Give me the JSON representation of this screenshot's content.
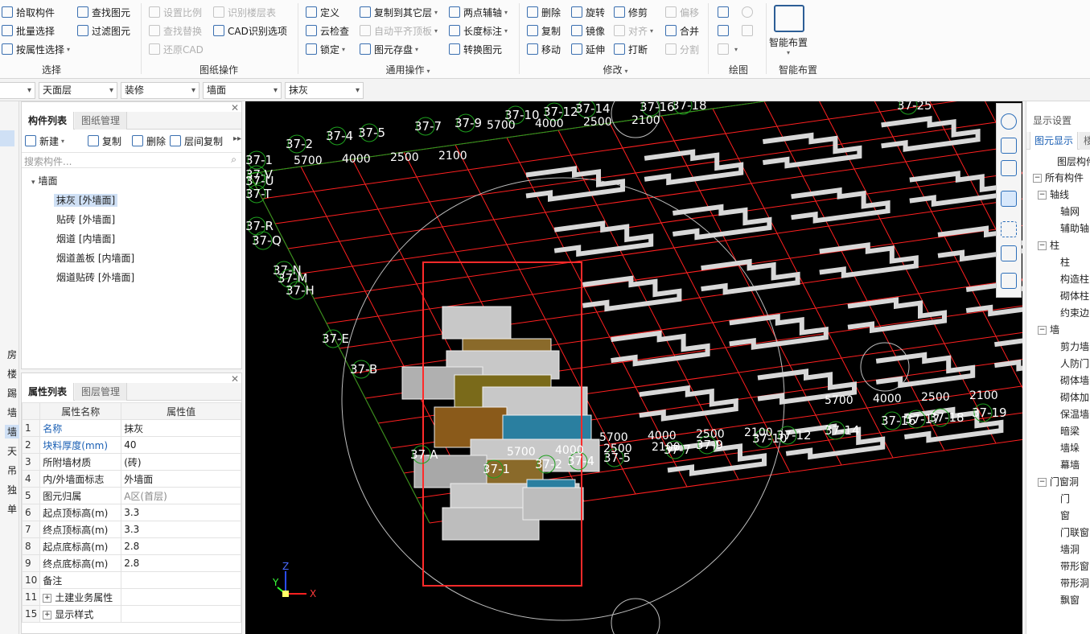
{
  "ribbon": {
    "select_group": {
      "items": [
        "拾取构件",
        "查找图元",
        "批量选择",
        "过滤图元",
        "按属性选择"
      ],
      "label": "选择"
    },
    "drawing_ops": {
      "items": [
        "设置比例",
        "识别楼层表",
        "查找替换",
        "CAD识别选项",
        "还原CAD"
      ],
      "label": "图纸操作"
    },
    "general_ops": {
      "items": [
        "定义",
        "复制到其它层",
        "两点辅轴",
        "云检查",
        "自动平齐顶板",
        "长度标注",
        "锁定",
        "图元存盘",
        "转换图元"
      ],
      "label": "通用操作"
    },
    "modify": {
      "items": [
        "删除",
        "旋转",
        "修剪",
        "偏移",
        "复制",
        "镜像",
        "对齐",
        "合并",
        "移动",
        "延伸",
        "打断",
        "分割"
      ],
      "label": "修改"
    },
    "draw": {
      "label": "绘图"
    },
    "smart": {
      "button": "智能布置",
      "label": "智能布置"
    }
  },
  "filters": [
    "天面层",
    "装修",
    "墙面",
    "抹灰"
  ],
  "left_strip": [
    "房",
    "楼",
    "踢",
    "墙",
    "墙",
    "天",
    "吊",
    "独",
    "单"
  ],
  "component_panel": {
    "tabs": [
      "构件列表",
      "图纸管理"
    ],
    "toolbar": [
      "新建",
      "复制",
      "删除",
      "层间复制"
    ],
    "search_placeholder": "搜索构件...",
    "tree_root": "墙面",
    "tree_items": [
      "抹灰 [外墙面]",
      "贴砖 [外墙面]",
      "烟道 [内墙面]",
      "烟道盖板 [内墙面]",
      "烟道贴砖 [外墙面]"
    ]
  },
  "property_panel": {
    "tabs": [
      "属性列表",
      "图层管理"
    ],
    "headers": [
      "属性名称",
      "属性值"
    ],
    "rows": [
      {
        "n": "1",
        "k": "名称",
        "v": "抹灰"
      },
      {
        "n": "2",
        "k": "块料厚度(mm)",
        "v": "40"
      },
      {
        "n": "3",
        "k": "所附墙材质",
        "v": "(砖)"
      },
      {
        "n": "4",
        "k": "内/外墙面标志",
        "v": "外墙面"
      },
      {
        "n": "5",
        "k": "图元归属",
        "v": "A区(首层)"
      },
      {
        "n": "6",
        "k": "起点顶标高(m)",
        "v": "3.3"
      },
      {
        "n": "7",
        "k": "终点顶标高(m)",
        "v": "3.3"
      },
      {
        "n": "8",
        "k": "起点底标高(m)",
        "v": "2.8"
      },
      {
        "n": "9",
        "k": "终点底标高(m)",
        "v": "2.8"
      },
      {
        "n": "10",
        "k": "备注",
        "v": ""
      },
      {
        "n": "11",
        "k": "土建业务属性",
        "v": ""
      },
      {
        "n": "15",
        "k": "显示样式",
        "v": ""
      }
    ]
  },
  "viewport": {
    "axis_labels_top": [
      "37-2",
      "37-4",
      "37-5",
      "37-7",
      "37-9",
      "37-10",
      "37-12",
      "37-14",
      "37-16",
      "37-18",
      "37-25"
    ],
    "axis_labels_left": [
      "37-1",
      "37-V",
      "37-U",
      "37-T",
      "37-R",
      "37-Q",
      "37-N",
      "37-M",
      "37-H",
      "37-E",
      "37-B",
      "37-A"
    ],
    "axis_labels_front": [
      "37-7",
      "37-9",
      "37-10",
      "37-12",
      "37-14",
      "37-16",
      "37-17",
      "37-18",
      "37-19",
      "37-1",
      "37-2",
      "37-4",
      "37-5"
    ],
    "dimensions": [
      "5700",
      "4000",
      "2500",
      "2100"
    ],
    "axes": {
      "x": "X",
      "y": "Y",
      "z": "Z"
    }
  },
  "right_panel": {
    "title": "显示设置",
    "tab": "图元显示",
    "tab2": "楼",
    "header": "图层构件",
    "items": [
      {
        "t": "所有构件",
        "lvl": 0,
        "pm": "−"
      },
      {
        "t": "轴线",
        "lvl": 1,
        "pm": "−"
      },
      {
        "t": "轴网",
        "lvl": 2
      },
      {
        "t": "辅助轴",
        "lvl": 2
      },
      {
        "t": "柱",
        "lvl": 1,
        "pm": "−"
      },
      {
        "t": "柱",
        "lvl": 2
      },
      {
        "t": "构造柱",
        "lvl": 2
      },
      {
        "t": "砌体柱",
        "lvl": 2
      },
      {
        "t": "约束边",
        "lvl": 2
      },
      {
        "t": "墙",
        "lvl": 1,
        "pm": "−"
      },
      {
        "t": "剪力墙",
        "lvl": 2
      },
      {
        "t": "人防门",
        "lvl": 2
      },
      {
        "t": "砌体墙",
        "lvl": 2
      },
      {
        "t": "砌体加",
        "lvl": 2
      },
      {
        "t": "保温墙",
        "lvl": 2
      },
      {
        "t": "暗梁",
        "lvl": 2
      },
      {
        "t": "墙垛",
        "lvl": 2
      },
      {
        "t": "幕墙",
        "lvl": 2
      },
      {
        "t": "门窗洞",
        "lvl": 1,
        "pm": "−"
      },
      {
        "t": "门",
        "lvl": 2
      },
      {
        "t": "窗",
        "lvl": 2
      },
      {
        "t": "门联窗",
        "lvl": 2
      },
      {
        "t": "墙洞",
        "lvl": 2
      },
      {
        "t": "带形窗",
        "lvl": 2
      },
      {
        "t": "带形洞",
        "lvl": 2
      },
      {
        "t": "飘窗",
        "lvl": 2
      }
    ]
  },
  "colors": {
    "grid": "#ff2020",
    "axis_label": "#ffffff",
    "axis_bubble": "#1fa11f",
    "highlight": "#ff2a2a"
  }
}
